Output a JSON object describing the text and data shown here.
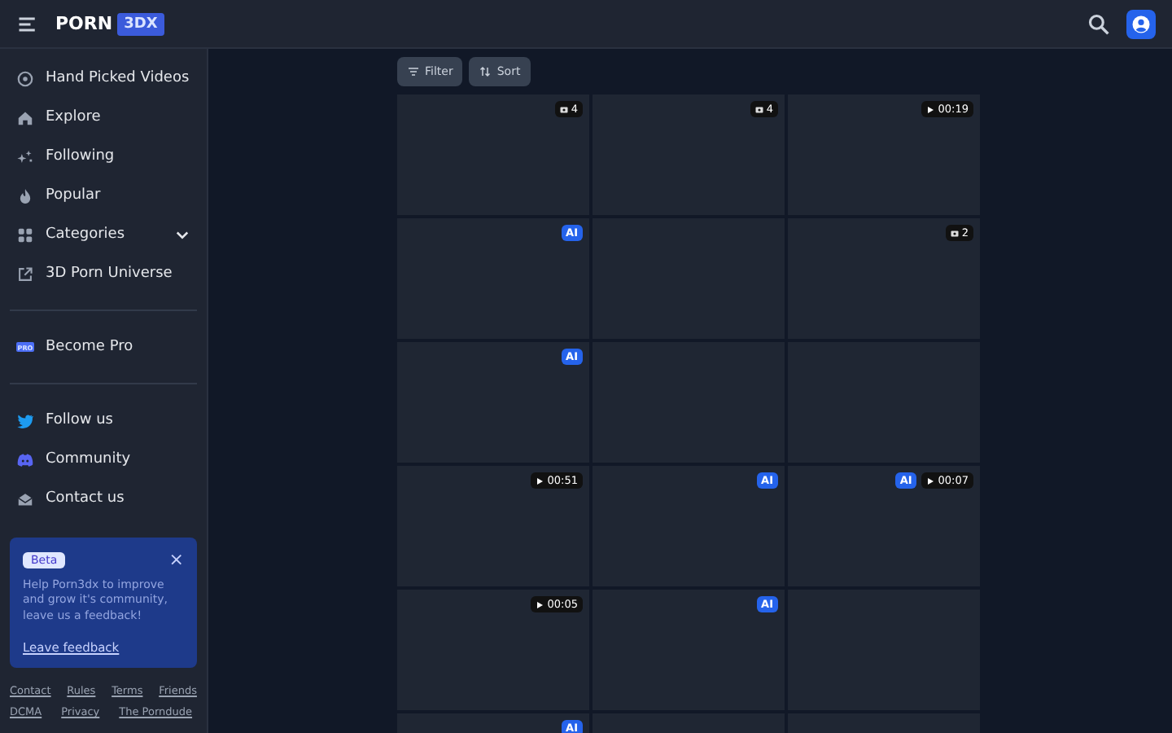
{
  "header": {
    "logo": "PORN",
    "logo_badge": "3DX"
  },
  "sidebar": {
    "groups": [
      [
        {
          "label": "Hand Picked Videos"
        },
        {
          "label": "Explore"
        },
        {
          "label": "Following"
        },
        {
          "label": "Popular"
        },
        {
          "label": "Categories",
          "expanded": false
        },
        {
          "label": "3D Porn Universe"
        }
      ],
      [
        {
          "label": "Become Pro",
          "icon_text": "PRO"
        }
      ],
      [
        {
          "label": "Follow us"
        },
        {
          "label": "Community"
        },
        {
          "label": "Contact us"
        }
      ]
    ]
  },
  "beta_card": {
    "badge": "Beta",
    "close": "×",
    "text": "Help Porn3dx to improve and grow it's community, leave us a feedback!",
    "link": "Leave feedback"
  },
  "footer_links": [
    [
      "Contact",
      "Rules",
      "Terms",
      "Friends"
    ],
    [
      "DCMA",
      "Privacy",
      "The Porndude"
    ]
  ],
  "toolbar": [
    {
      "label": "Filter"
    },
    {
      "label": "Sort"
    }
  ],
  "tiles": [
    {
      "kind": "placeholder",
      "badges": [
        {
          "kind": "photos",
          "text": "4"
        }
      ]
    },
    {
      "kind": "placeholder",
      "badges": [
        {
          "kind": "photos",
          "text": "4"
        }
      ]
    },
    {
      "kind": "placeholder",
      "badges": [
        {
          "kind": "video",
          "text": "00:19"
        }
      ]
    },
    {
      "kind": "placeholder",
      "badges": [
        {
          "kind": "ai",
          "text": "AI"
        }
      ]
    },
    {
      "kind": "placeholder"
    },
    {
      "kind": "placeholder",
      "badges": [
        {
          "kind": "photos",
          "text": "2"
        }
      ]
    },
    {
      "kind": "placeholder",
      "badges": [
        {
          "kind": "ai",
          "text": "AI"
        }
      ]
    },
    {
      "kind": "placeholder"
    },
    {
      "kind": "placeholder"
    },
    {
      "kind": "placeholder",
      "badges": [
        {
          "kind": "video",
          "text": "00:51"
        }
      ]
    },
    {
      "kind": "placeholder",
      "badges": [
        {
          "kind": "ai",
          "text": "AI"
        }
      ]
    },
    {
      "kind": "placeholder",
      "badges": [
        {
          "kind": "ai",
          "text": "AI"
        },
        {
          "kind": "video",
          "text": "00:07"
        }
      ]
    },
    {
      "kind": "placeholder",
      "badges": [
        {
          "kind": "video",
          "text": "00:05"
        }
      ]
    },
    {
      "kind": "placeholder",
      "badges": [
        {
          "kind": "ai",
          "text": "AI"
        }
      ]
    },
    {
      "kind": "placeholder"
    },
    {
      "kind": "placeholder",
      "badges": [
        {
          "kind": "ai",
          "text": "AI"
        }
      ]
    },
    {
      "kind": "placeholder"
    },
    {
      "kind": "placeholder"
    }
  ]
}
